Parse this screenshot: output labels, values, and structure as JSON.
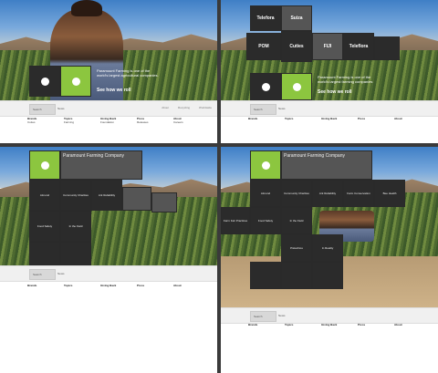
{
  "panels": {
    "tl": {
      "tagline": "Paramount Farming is one of the world's largest agricultural companies.",
      "link": "See how we roll",
      "label": "Innovation"
    },
    "tr": {
      "brands": [
        "Telefora",
        "Suiza",
        "POM",
        "Cuties",
        "FIJI",
        "Teleflora"
      ],
      "link": "See how we roll",
      "tagline": "Paramount Farming is one of the world's largest farming companies"
    },
    "bl": {
      "company": "Paramount Farming Company"
    },
    "br": {
      "company": "Paramount Farming Company"
    }
  },
  "nav": {
    "search": "Search",
    "news": "News",
    "links": [
      "About",
      "Recycling",
      "Worldwide"
    ]
  },
  "footer": {
    "columns": [
      {
        "title": "Brands",
        "items": [
          "Cuties",
          "Wonderful",
          "POM",
          "Fiji Water",
          "Teleflora"
        ]
      },
      {
        "title": "Topics",
        "items": [
          "Farming",
          "Growing",
          "Water",
          "Soil"
        ]
      },
      {
        "title": "Giving Back",
        "items": [
          "Foundation",
          "Community",
          "Education"
        ]
      },
      {
        "title": "Press",
        "items": [
          "Releases",
          "Media"
        ]
      },
      {
        "title": "About",
        "items": [
          "Careers",
          "Contact"
        ]
      }
    ]
  },
  "grid": {
    "bl_tiles": [
      "Almond",
      "Community Charities",
      "Ark Reliability",
      "Food Safety",
      "In the Field"
    ],
    "br_tiles": [
      "Almond",
      "Community Charities",
      "Ark Reliability",
      "Farm Conservation",
      "Bee Health",
      "Farm Fair Practices",
      "Food Safety",
      "In the Field",
      "Pistachios",
      "In Reality"
    ]
  }
}
